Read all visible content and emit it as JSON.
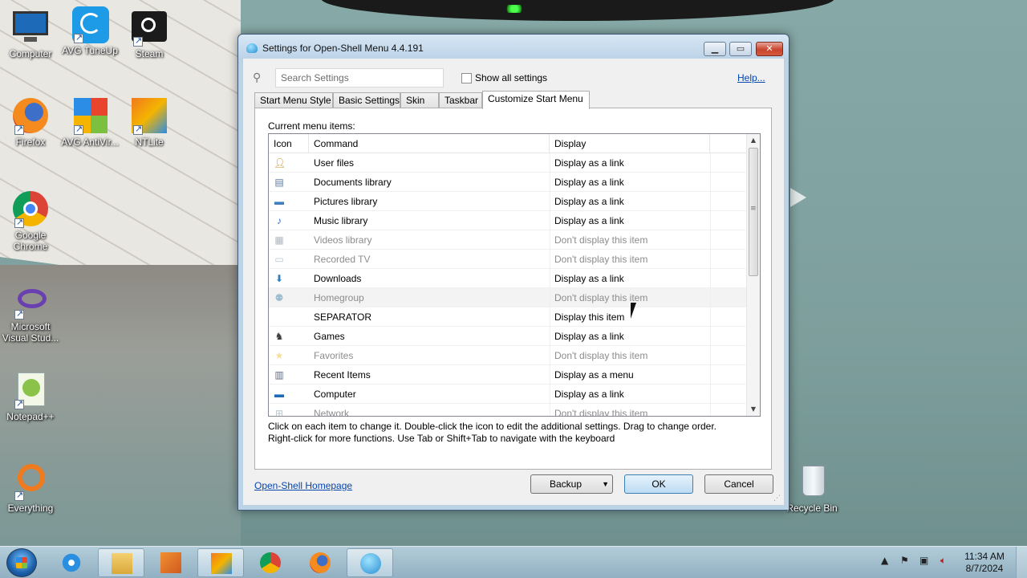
{
  "desktop": {
    "icons": [
      {
        "label": "Computer",
        "icon": "computer-icon"
      },
      {
        "label": "AVG TuneUp",
        "icon": "avg-tuneup-icon"
      },
      {
        "label": "Steam",
        "icon": "steam-icon"
      },
      {
        "label": "Firefox",
        "icon": "firefox-icon"
      },
      {
        "label": "AVG AntiVir...",
        "icon": "avg-antivirus-icon"
      },
      {
        "label": "NTLite",
        "icon": "ntlite-icon"
      },
      {
        "label": "Google Chrome",
        "icon": "chrome-icon"
      },
      {
        "label": "Microsoft Visual Stud...",
        "icon": "visual-studio-icon"
      },
      {
        "label": "Notepad++",
        "icon": "notepadpp-icon"
      },
      {
        "label": "Everything",
        "icon": "everything-icon"
      },
      {
        "label": "Recycle Bin",
        "icon": "recycle-bin-icon"
      }
    ]
  },
  "dialog": {
    "title": "Settings for Open-Shell Menu 4.4.191",
    "search_placeholder": "Search Settings",
    "show_all_label": "Show all settings",
    "help_label": "Help...",
    "tabs": [
      {
        "label": "Start Menu Style"
      },
      {
        "label": "Basic Settings"
      },
      {
        "label": "Skin"
      },
      {
        "label": "Taskbar"
      },
      {
        "label": "Customize Start Menu"
      }
    ],
    "active_tab": "Customize Start Menu",
    "current_items_label": "Current menu items:",
    "columns": {
      "icon": "Icon",
      "command": "Command",
      "display": "Display"
    },
    "rows": [
      {
        "icon": "user-files-icon",
        "command": "User files",
        "display": "Display as a link",
        "enabled": true
      },
      {
        "icon": "documents-icon",
        "command": "Documents library",
        "display": "Display as a link",
        "enabled": true
      },
      {
        "icon": "pictures-icon",
        "command": "Pictures library",
        "display": "Display as a link",
        "enabled": true
      },
      {
        "icon": "music-icon",
        "command": "Music library",
        "display": "Display as a link",
        "enabled": true
      },
      {
        "icon": "videos-icon",
        "command": "Videos library",
        "display": "Don't display this item",
        "enabled": false
      },
      {
        "icon": "recorded-tv-icon",
        "command": "Recorded TV",
        "display": "Don't display this item",
        "enabled": false
      },
      {
        "icon": "downloads-icon",
        "command": "Downloads",
        "display": "Display as a link",
        "enabled": true
      },
      {
        "icon": "homegroup-icon",
        "command": "Homegroup",
        "display": "Don't display this item",
        "enabled": false
      },
      {
        "icon": "",
        "command": "SEPARATOR",
        "display": "Display this item",
        "enabled": true
      },
      {
        "icon": "games-icon",
        "command": "Games",
        "display": "Display as a link",
        "enabled": true
      },
      {
        "icon": "favorites-icon",
        "command": "Favorites",
        "display": "Don't display this item",
        "enabled": false
      },
      {
        "icon": "recent-items-icon",
        "command": "Recent Items",
        "display": "Display as a menu",
        "enabled": true
      },
      {
        "icon": "computer-icon",
        "command": "Computer",
        "display": "Display as a link",
        "enabled": true
      },
      {
        "icon": "network-icon",
        "command": "Network",
        "display": "Don't display this item",
        "enabled": false
      }
    ],
    "hint_line1": "Click on each item to change it. Double-click the icon to edit the additional settings. Drag to change order.",
    "hint_line2": "Right-click for more functions. Use Tab or Shift+Tab to navigate with the keyboard",
    "homepage_label": "Open-Shell Homepage",
    "backup_label": "Backup",
    "ok_label": "OK",
    "cancel_label": "Cancel"
  },
  "taskbar": {
    "apps": [
      {
        "icon": "internet-explorer-icon",
        "active": false
      },
      {
        "icon": "file-explorer-icon",
        "active": true
      },
      {
        "icon": "media-player-icon",
        "active": false
      },
      {
        "icon": "ntlite-icon",
        "active": true
      },
      {
        "icon": "chrome-icon",
        "active": false
      },
      {
        "icon": "firefox-icon",
        "active": false
      },
      {
        "icon": "open-shell-icon",
        "active": true
      }
    ],
    "time": "11:34 AM",
    "date": "8/7/2024"
  },
  "colors": {
    "accent_link": "#0645ad",
    "ok_border": "#3c7fb1",
    "close_red": "#c9442d"
  }
}
